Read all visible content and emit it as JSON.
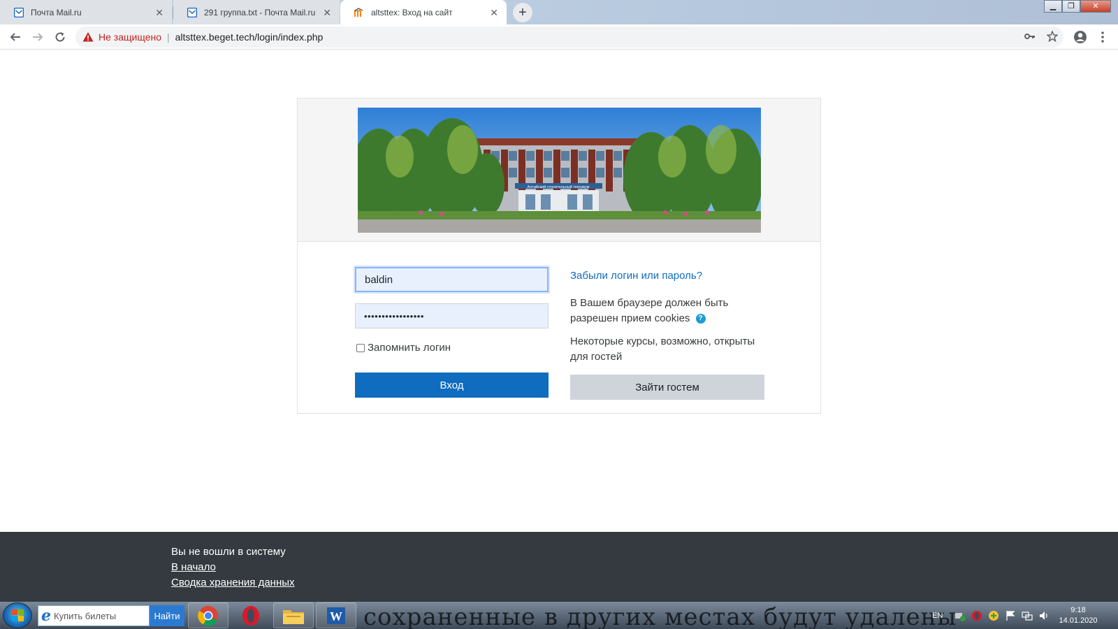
{
  "browser": {
    "tabs": [
      {
        "label": "Почта Mail.ru",
        "close": "✕"
      },
      {
        "label": "291 группа.txt - Почта Mail.ru",
        "close": "✕"
      },
      {
        "label": "altsttex: Вход на сайт",
        "close": "✕"
      }
    ],
    "new_tab": "+",
    "window_controls": {
      "minimize": "▁",
      "restore": "❐",
      "close": "✕"
    },
    "security_label": "Не защищено",
    "url_separator": "|",
    "url": "altsttex.beget.tech/login/index.php",
    "icons": [
      "back-arrow-icon",
      "forward-arrow-icon",
      "reload-icon",
      "warning-icon",
      "key-icon",
      "star-icon",
      "account-icon",
      "more-vert-icon"
    ]
  },
  "login": {
    "username": "baldin",
    "password_masked": "•••••••••••••••••",
    "remember_label": "Запомнить логин",
    "login_button": "Вход",
    "forgot_link": "Забыли логин или пароль?",
    "cookies_text_1": "В Вашем браузере должен быть",
    "cookies_text_2": "разрешен прием cookies",
    "help_glyph": "?",
    "guest_text_1": "Некоторые курсы, возможно, открыты",
    "guest_text_2": "для гостей",
    "guest_button": "Зайти гостем"
  },
  "banner": {
    "sign": "Алтайский строительный техникум"
  },
  "footer": {
    "not_logged": "Вы не вошли в систему",
    "home_link": "В начало",
    "data_summary_link": "Сводка хранения данных"
  },
  "taskbar": {
    "search_placeholder": "Купить билеты",
    "search_button": "Найти",
    "search_e": "e",
    "word_glyph": "W",
    "watermark": "сохраненные в других местах будут удалены",
    "language": "EN",
    "time": "9:18",
    "date": "14.01.2020"
  },
  "colors": {
    "accent": "#0f6cbf",
    "footer_bg": "#343a40",
    "unsafe_red": "#c5221f"
  }
}
